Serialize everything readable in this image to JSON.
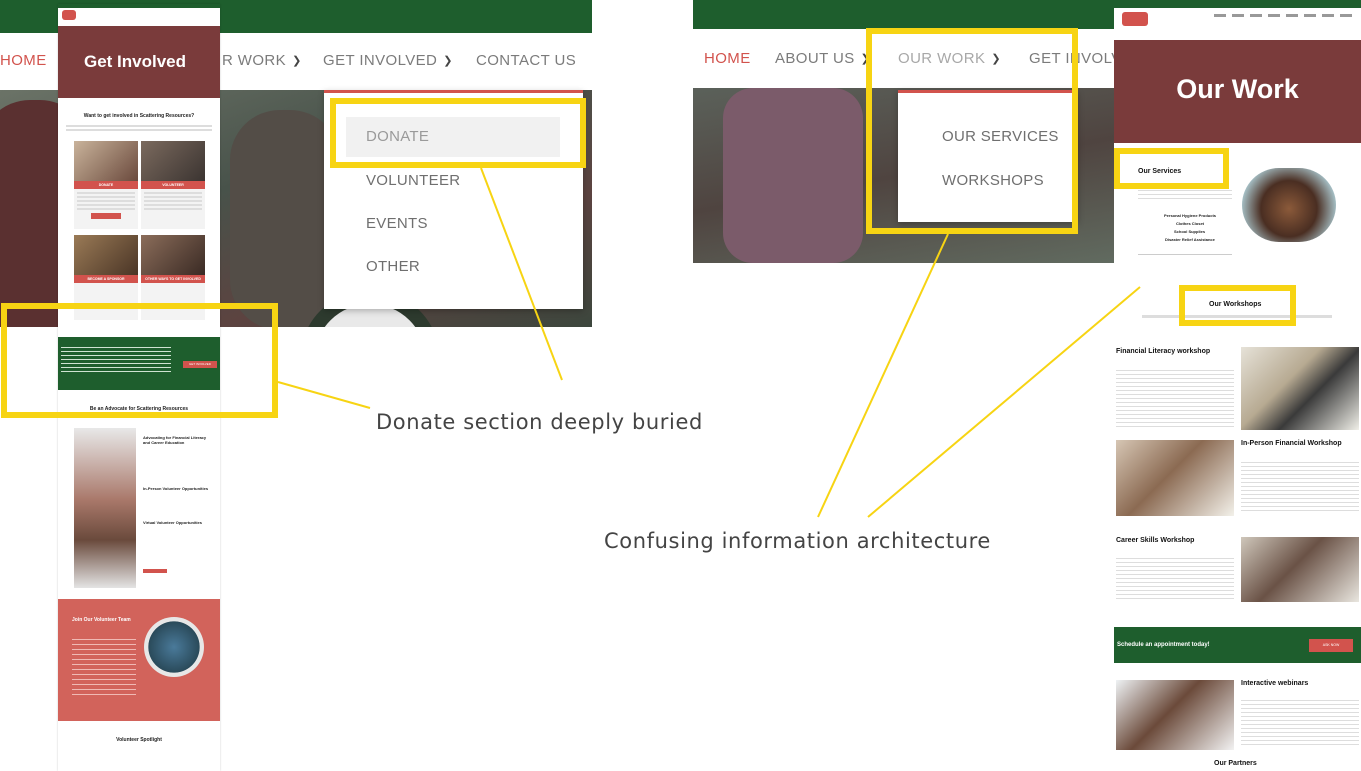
{
  "colors": {
    "accent": "#d2534d",
    "header_green": "#1e5e2d",
    "hero_maroon": "#7a3b3b",
    "highlight": "#f7d413"
  },
  "left_nav": {
    "items": [
      {
        "label": "HOME"
      },
      {
        "label": "R WORK"
      },
      {
        "label": "GET INVOLVED"
      },
      {
        "label": "CONTACT US"
      }
    ],
    "dropdown": {
      "items": [
        "DONATE",
        "VOLUNTEER",
        "EVENTS",
        "OTHER"
      ]
    }
  },
  "left_page": {
    "hero_title": "Get Involved",
    "intro_heading": "Want to get involved in Scattering Resources?",
    "cards": [
      {
        "label": "DONATE"
      },
      {
        "label": "VOLUNTEER"
      },
      {
        "label": "BECOME A SPONSOR"
      },
      {
        "label": "OTHER WAYS TO GET INVOLVED"
      }
    ],
    "green_button": "GET INVOLVED",
    "advocate_heading": "Be an Advocate for Scattering Resources",
    "advocate_items": [
      "Advocating for Financial Literacy and Career Education",
      "In-Person Volunteer Opportunities",
      "Virtual Volunteer Opportunities"
    ],
    "join_heading": "Join Our Volunteer Team",
    "spotlight_heading": "Volunteer Spotlight"
  },
  "right_nav": {
    "items": [
      {
        "label": "HOME"
      },
      {
        "label": "ABOUT US"
      },
      {
        "label": "OUR WORK"
      },
      {
        "label": "GET INVOLV"
      }
    ],
    "dropdown": {
      "items": [
        "OUR SERVICES",
        "WORKSHOPS"
      ]
    }
  },
  "right_page": {
    "hero_title": "Our Work",
    "services_heading": "Our Services",
    "services_list": [
      "Personal Hygiene Products",
      "Clothes Closet",
      "School Supplies",
      "Disaster Relief Assistance"
    ],
    "workshops_heading": "Our Workshops",
    "workshops": [
      {
        "title": "Financial Literacy workshop"
      },
      {
        "title": "In-Person Financial Workshop"
      },
      {
        "title": "Career Skills Workshop"
      }
    ],
    "appointment_text": "Schedule an appointment today!",
    "appointment_button": "ASK NOW",
    "webinars_heading": "Interactive webinars",
    "partners_heading": "Our Partners"
  },
  "callouts": {
    "donate_caption": "Donate section deeply buried",
    "ia_caption": "Confusing information architecture"
  }
}
